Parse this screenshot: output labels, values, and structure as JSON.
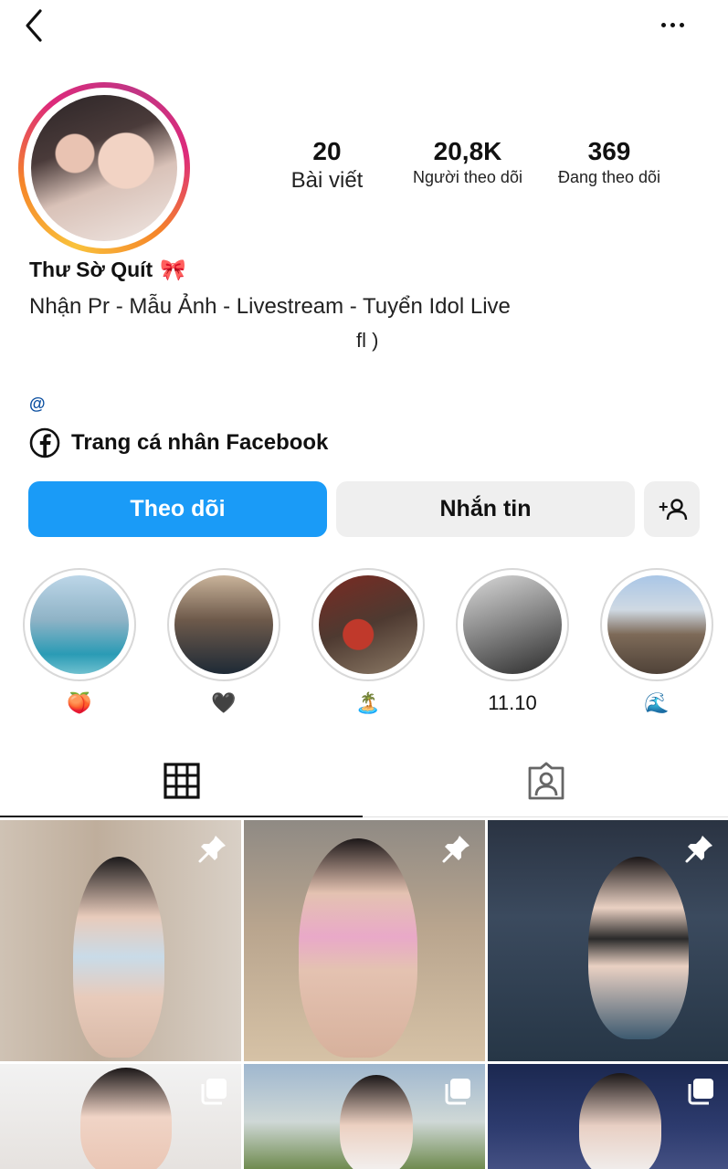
{
  "header": {
    "back_icon": "chevron-left-icon",
    "more_icon": "more-horizontal-icon"
  },
  "profile": {
    "stats": [
      {
        "value": "20",
        "label": "Bài viết"
      },
      {
        "value": "20,8K",
        "label": "Người theo dõi"
      },
      {
        "value": "369",
        "label": "Đang theo dõi"
      }
    ],
    "name": "Thư Sờ Quít",
    "name_emoji": "🎀",
    "bio_line1": "Nhận Pr - Mẫu Ảnh - Livestream - Tuyển Idol Live",
    "bio_line2": "fl )",
    "at_symbol": "@",
    "facebook_link": "Trang cá nhân Facebook"
  },
  "actions": {
    "follow": "Theo dõi",
    "message": "Nhắn tin",
    "add_person_icon": "add-person-icon"
  },
  "highlights": [
    {
      "caption": "🍑"
    },
    {
      "caption": "🖤"
    },
    {
      "caption": "🏝️"
    },
    {
      "caption": "11.10"
    },
    {
      "caption": "🌊"
    }
  ],
  "tabs": {
    "grid_icon": "grid-icon",
    "tagged_icon": "tagged-person-icon"
  },
  "colors": {
    "follow_button": "#1a9bf7",
    "secondary_button": "#efefef"
  }
}
